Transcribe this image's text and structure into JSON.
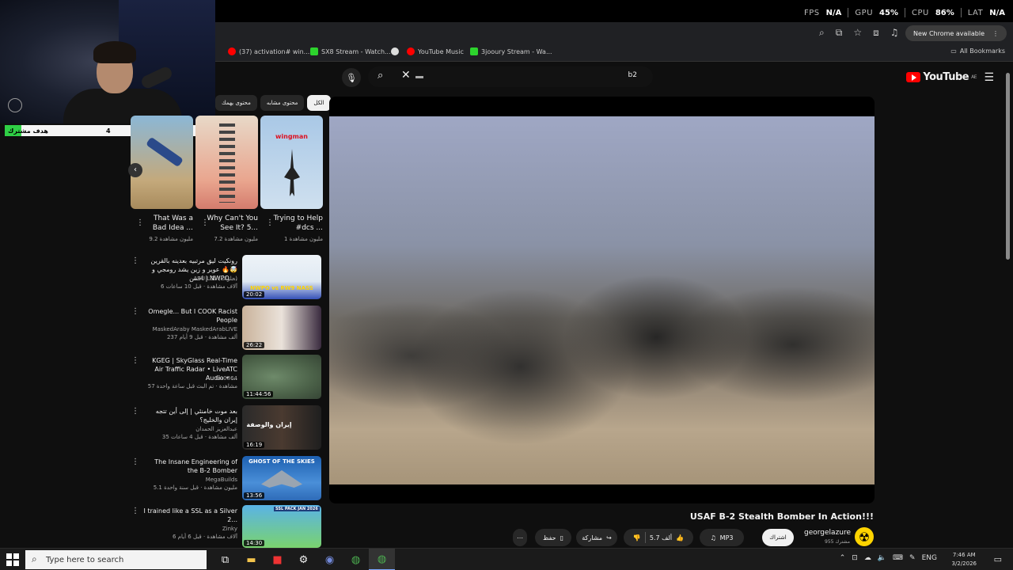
{
  "overlay": {
    "fps_label": "FPS",
    "fps_value": "N/A",
    "gpu_label": "GPU",
    "gpu_value": "45%",
    "cpu_label": "CPU",
    "cpu_value": "86%",
    "lat_label": "LAT",
    "lat_value": "N/A",
    "sub_goal": {
      "label": "هدف مشترك",
      "current": "4",
      "target": "50",
      "progress": 0.08
    }
  },
  "browser": {
    "new_chrome_label": "New Chrome available",
    "bookmarks": [
      {
        "label": "(37) activation# win...",
        "color": "#ff0000"
      },
      {
        "label": "SX8 Stream - Watch...",
        "color": "#2dd42d"
      },
      {
        "label": "",
        "color": "#dddddd"
      },
      {
        "label": "YouTube Music",
        "color": "#ff0000"
      },
      {
        "label": "3jooury Stream - Wa...",
        "color": "#2dd42d"
      }
    ],
    "all_bookmarks": "All Bookmarks"
  },
  "youtube": {
    "logo_text": "YouTube",
    "logo_region": "AE",
    "search_query": "b2",
    "chips": [
      "محتوى يهمك",
      "محتوى مشابه",
      "الكل"
    ],
    "shorts": [
      {
        "title": "That Was a Bad Idea ...",
        "views": "9.2 مليون مشاهدة",
        "overlay_text": ""
      },
      {
        "title": "Why Can't You See It? 5...",
        "views": "7.2 مليون مشاهدة",
        "overlay_text": ""
      },
      {
        "title": "Trying to Help #dcs ...",
        "views": "1 مليون مشاهدة",
        "overlay_text": "wingman"
      }
    ],
    "recommendations": [
      {
        "title": "رونكيت ليق مرتبيه بعدينه بالقرين 🤯🔥 عوير و زين يشد رومجي و اخمن | NWPO ...",
        "channel": "ABU LEL (حلوات)",
        "meta": "6 آلاف مشاهدة · قبل 10 ساعات",
        "duration": "20:02",
        "thumb_text": "NWPO vs RW9 NASS"
      },
      {
        "title": "Omegle... But I COOK Racist People",
        "channel": "MaskedAraby MaskedArabLIVE",
        "meta": "237 ألف مشاهدة · قبل 9 أيام",
        "duration": "26:22",
        "thumb_text": ""
      },
      {
        "title": "KGEG | SkyGlass Real-Time Air Traffic Radar • LiveATC Audio • ...",
        "channel": "Liz0864",
        "meta": "57 مشاهدة · تم البث قبل ساعة واحدة",
        "duration": "11:44:56",
        "thumb_text": ""
      },
      {
        "title": "بعد موت خامنئي | إلى أين تتجه إيران والخليج؟",
        "channel": "عبدالعزيز الحمدان",
        "meta": "35 ألف مشاهدة · قبل 4 ساعات",
        "duration": "16:19",
        "thumb_text": "إيران والوصفة"
      },
      {
        "title": "The Insane Engineering of the B-2 Bomber",
        "channel": "MegaBuilds",
        "meta": "5.1 مليون مشاهدة · قبل سنة واحدة",
        "duration": "13:56",
        "thumb_text": "GHOST OF THE SKIES"
      },
      {
        "title": "I trained like a SSL as a Silver 2...",
        "channel": "Zinky",
        "meta": "6 آلاف مشاهدة · قبل 6 أيام",
        "duration": "14:30",
        "thumb_text": "SSL PACK JAN 2026"
      }
    ],
    "video": {
      "title": "USAF B-2 Stealth Bomber In Action!!!",
      "channel": "georgelazure",
      "subscribers": "955 مشترك",
      "subscribe_label": "اشتراك",
      "likes": "5.7 ألف",
      "share_label": "مشاركة",
      "save_label": "حفظ",
      "mp3_label": "MP3",
      "avatar_glyph": "☢"
    }
  },
  "taskbar": {
    "search_placeholder": "Type here to search",
    "lang": "ENG",
    "time": "7:46 AM",
    "date": "3/2/2026"
  }
}
